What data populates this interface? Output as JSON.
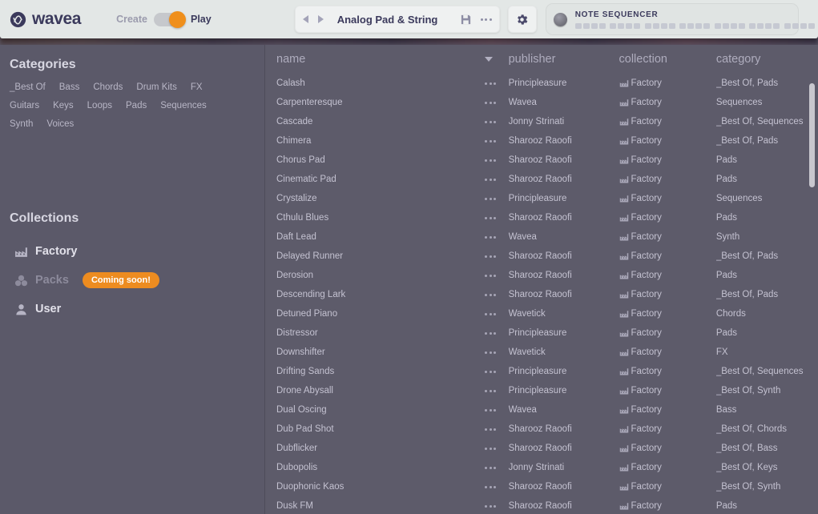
{
  "header": {
    "brand": "wavea",
    "mode_toggle": {
      "left_label": "Create",
      "right_label": "Play",
      "active": "Play"
    },
    "preset": {
      "name": "Analog Pad & String",
      "prev_icon": "triangle-left-icon",
      "next_icon": "triangle-right-icon",
      "save_icon": "floppy-disk-icon",
      "more_icon": "ellipsis-icon"
    },
    "settings_icon": "gear-icon",
    "sequencer": {
      "title": "NOTE SEQUENCER",
      "knob_icon": "rotary-knob-icon",
      "step_groups": 8,
      "steps_per_group": 4
    }
  },
  "sidebar": {
    "categories_title": "Categories",
    "categories": [
      "_Best Of",
      "Bass",
      "Chords",
      "Drum Kits",
      "FX",
      "Guitars",
      "Keys",
      "Loops",
      "Pads",
      "Sequences",
      "Synth",
      "Voices"
    ],
    "collections_title": "Collections",
    "collections": [
      {
        "label": "Factory",
        "icon": "factory-icon",
        "disabled": false,
        "badge": null
      },
      {
        "label": "Packs",
        "icon": "packs-icon",
        "disabled": true,
        "badge": "Coming soon!"
      },
      {
        "label": "User",
        "icon": "user-icon",
        "disabled": false,
        "badge": null
      }
    ]
  },
  "table": {
    "columns": [
      "name",
      "publisher",
      "collection",
      "category"
    ],
    "sort_column": "name",
    "sort_direction": "descending",
    "row_menu_icon": "ellipsis-icon",
    "collection_icon": "factory-icon",
    "rows": [
      {
        "name": "Calash",
        "publisher": "Principleasure",
        "collection": "Factory",
        "category": "_Best Of, Pads"
      },
      {
        "name": "Carpenteresque",
        "publisher": "Wavea",
        "collection": "Factory",
        "category": "Sequences"
      },
      {
        "name": "Cascade",
        "publisher": "Jonny Strinati",
        "collection": "Factory",
        "category": "_Best Of, Sequences"
      },
      {
        "name": "Chimera",
        "publisher": "Sharooz Raoofi",
        "collection": "Factory",
        "category": "_Best Of, Pads"
      },
      {
        "name": "Chorus Pad",
        "publisher": "Sharooz Raoofi",
        "collection": "Factory",
        "category": "Pads"
      },
      {
        "name": "Cinematic Pad",
        "publisher": "Sharooz Raoofi",
        "collection": "Factory",
        "category": "Pads"
      },
      {
        "name": "Crystalize",
        "publisher": "Principleasure",
        "collection": "Factory",
        "category": "Sequences"
      },
      {
        "name": "Cthulu Blues",
        "publisher": "Sharooz Raoofi",
        "collection": "Factory",
        "category": "Pads"
      },
      {
        "name": "Daft Lead",
        "publisher": "Wavea",
        "collection": "Factory",
        "category": "Synth"
      },
      {
        "name": "Delayed Runner",
        "publisher": "Sharooz Raoofi",
        "collection": "Factory",
        "category": "_Best Of, Pads"
      },
      {
        "name": "Derosion",
        "publisher": "Sharooz Raoofi",
        "collection": "Factory",
        "category": "Pads"
      },
      {
        "name": "Descending Lark",
        "publisher": "Sharooz Raoofi",
        "collection": "Factory",
        "category": "_Best Of, Pads"
      },
      {
        "name": "Detuned Piano",
        "publisher": "Wavetick",
        "collection": "Factory",
        "category": "Chords"
      },
      {
        "name": "Distressor",
        "publisher": "Principleasure",
        "collection": "Factory",
        "category": "Pads"
      },
      {
        "name": "Downshifter",
        "publisher": "Wavetick",
        "collection": "Factory",
        "category": "FX"
      },
      {
        "name": "Drifting Sands",
        "publisher": "Principleasure",
        "collection": "Factory",
        "category": "_Best Of, Sequences"
      },
      {
        "name": "Drone Abysall",
        "publisher": "Principleasure",
        "collection": "Factory",
        "category": "_Best Of, Synth"
      },
      {
        "name": "Dual Oscing",
        "publisher": "Wavea",
        "collection": "Factory",
        "category": "Bass"
      },
      {
        "name": "Dub Pad Shot",
        "publisher": "Sharooz Raoofi",
        "collection": "Factory",
        "category": "_Best Of, Chords"
      },
      {
        "name": "Dubflicker",
        "publisher": "Sharooz Raoofi",
        "collection": "Factory",
        "category": "_Best Of, Bass"
      },
      {
        "name": "Dubopolis",
        "publisher": "Jonny Strinati",
        "collection": "Factory",
        "category": "_Best Of, Keys"
      },
      {
        "name": "Duophonic Kaos",
        "publisher": "Sharooz Raoofi",
        "collection": "Factory",
        "category": "_Best Of, Synth"
      },
      {
        "name": "Dusk FM",
        "publisher": "Sharooz Raoofi",
        "collection": "Factory",
        "category": "Pads"
      }
    ]
  },
  "colors": {
    "accent_orange": "#ef8f1c",
    "header_bg": "#e3e7e6",
    "sidebar_bg": "#5b5969",
    "content_bg": "#5d5b6a",
    "text_dark": "#3b3a5c",
    "text_light": "#c4c2d1"
  }
}
